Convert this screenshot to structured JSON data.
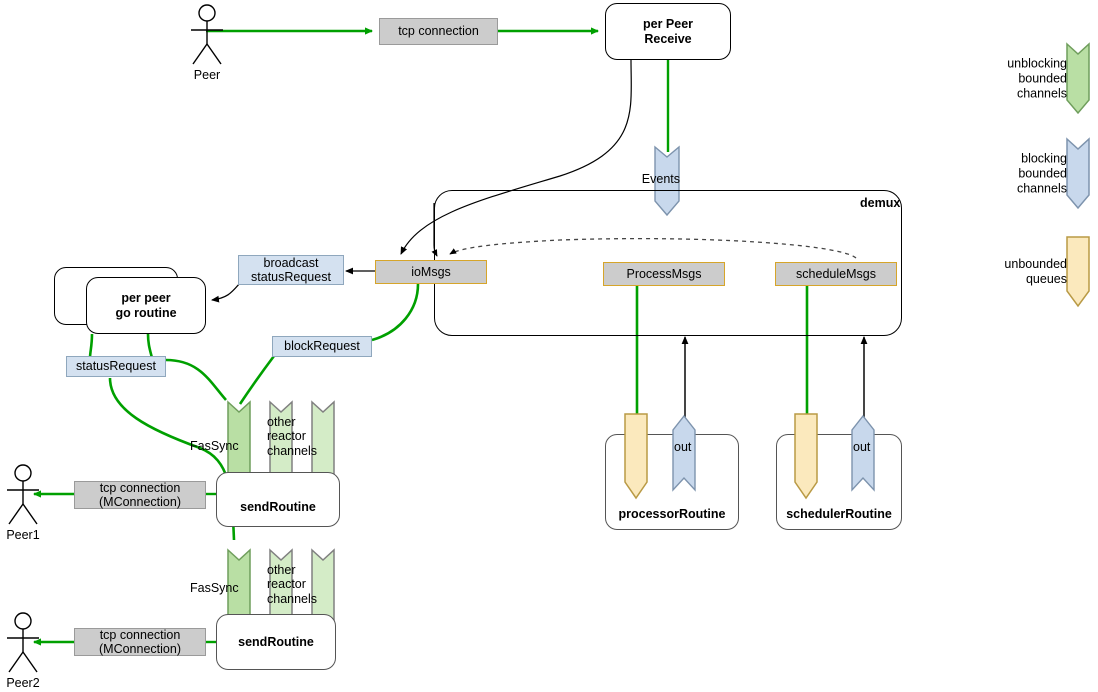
{
  "diagram": {
    "title": "tendermint reactor goroutine / channel dataflow",
    "colors": {
      "flow_green": "#00a000",
      "wire_black": "#000000",
      "grey_fill": "#cccccc",
      "grey_stroke": "#9a9a9a",
      "msg_border": "#d6a52a",
      "blue_fill": "#d4e1f0",
      "blue_stroke": "#8fa7bd",
      "chan_green_fill": "#b9dfa4",
      "chan_green_stroke": "#6f9e5c",
      "chan_blue_fill": "#c8d8ec",
      "chan_blue_stroke": "#7d93ad",
      "queue_tan_fill": "#fbe9bd",
      "queue_tan_stroke": "#b99a45",
      "chan_grey_stroke": "#808080"
    }
  },
  "actors": [
    {
      "name": "Peer",
      "label": "Peer"
    },
    {
      "name": "Peer1",
      "label": "Peer1"
    },
    {
      "name": "Peer2",
      "label": "Peer2"
    }
  ],
  "connections": {
    "top": "tcp connection",
    "peer1_line1": "tcp connection",
    "peer1_line2": "(MConnection)",
    "peer2_line1": "tcp connection",
    "peer2_line2": "(MConnection)"
  },
  "nodes": {
    "per_peer_receive_line1": "per Peer",
    "per_peer_receive_line2": "Receive",
    "per_peer_goroutine_line1": "per peer",
    "per_peer_goroutine_line2": "go routine",
    "send_routine_1": "sendRoutine",
    "send_routine_2": "sendRoutine",
    "processor_routine": "processorRoutine",
    "scheduler_routine": "schedulerRoutine",
    "demux": "demux"
  },
  "messages": {
    "io_msgs": "ioMsgs",
    "process_msgs": "ProcessMsgs",
    "schedule_msgs": "scheduleMsgs"
  },
  "labels": {
    "broadcast_status_request_line1": "broadcast",
    "broadcast_status_request_line2": "statusRequest",
    "status_request": "statusRequest",
    "block_request": "blockRequest"
  },
  "channels": {
    "events": "Events",
    "fassync_1": "FasSync",
    "fassync_2": "FasSync",
    "other_reactor_1_line1": "other",
    "other_reactor_1_line2": "reactor",
    "other_reactor_1_line3": "channels",
    "other_reactor_2_line1": "other",
    "other_reactor_2_line2": "reactor",
    "other_reactor_2_line3": "channels",
    "processor_out": "out",
    "scheduler_out": "out"
  },
  "legend": [
    {
      "name": "unblocking-bounded-channels",
      "line1": "unblocking",
      "line2": "bounded",
      "line3": "channels",
      "kind": "green"
    },
    {
      "name": "blocking-bounded-channels",
      "line1": "blocking",
      "line2": "bounded",
      "line3": "channels",
      "kind": "blue"
    },
    {
      "name": "unbounded-queues",
      "line1": "unbounded",
      "line2": "queues",
      "line3": "",
      "kind": "tan"
    }
  ]
}
